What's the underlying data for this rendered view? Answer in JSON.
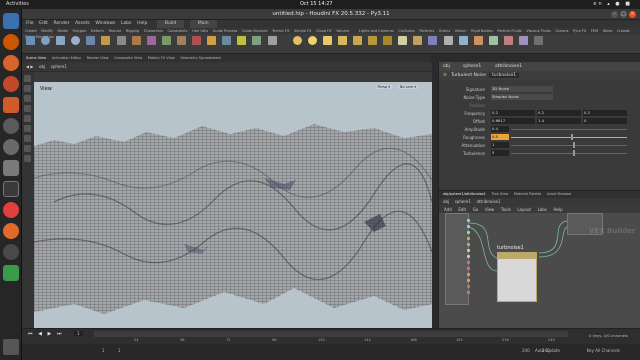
{
  "system": {
    "activities": "Activities",
    "clock": "Oct 15  14:27",
    "tray": "en  ▴  ●  ■"
  },
  "window": {
    "title": "untitled.hip - Houdini FX 20.5.332 - Py3.11"
  },
  "menu": [
    "File",
    "Edit",
    "Render",
    "Assets",
    "Windows",
    "Labs",
    "Help",
    "Build",
    "Main"
  ],
  "shelf_tabs": [
    "Create",
    "Modify",
    "Model",
    "Polygon",
    "Deform",
    "Texture",
    "Rigging",
    "Characters",
    "Constraints",
    "Hair Utils",
    "Guide Process",
    "Guide Brushes",
    "Terrain FX",
    "Simple FX",
    "Cloud FX",
    "Volume",
    "Lights and Cameras",
    "Collisions",
    "Particles",
    "Grains",
    "Vellum",
    "Rigid Bodies",
    "Particle Fluids",
    "Viscous Fluids",
    "Oceans",
    "Pyro FX",
    "FEM",
    "Wires",
    "Crowds",
    "Drive Simulation"
  ],
  "pane_tabs": [
    "Scene View",
    "Animation Editor",
    "Render View",
    "Composite View",
    "Motion FX View",
    "Geometry Spreadsheet"
  ],
  "viewport": {
    "path_obj": "obj",
    "path_node": "sphere1",
    "label": "View",
    "camera": "Persp ▾",
    "display": "No cam ▾"
  },
  "params": {
    "node_type": "Turbulent Noise",
    "node_name": "turbnoise1",
    "path_obj": "obj",
    "path_node": "sphere1",
    "path_ops": "attribnoise1",
    "rows": [
      {
        "label": "Signature",
        "values": [
          "3D Noise"
        ]
      },
      {
        "label": "Noise Type",
        "values": [
          "Simplex Noise"
        ]
      },
      {
        "label": "Position",
        "values": []
      },
      {
        "label": "Frequency",
        "values": [
          "0.2",
          "0.2",
          "0.2"
        ]
      },
      {
        "label": "Offset",
        "values": [
          "0.6617",
          "1.4",
          "0"
        ]
      },
      {
        "label": "Amplitude",
        "values": [
          "0.4"
        ]
      },
      {
        "label": "Roughness",
        "values": [
          "0.5"
        ]
      },
      {
        "label": "Attenuation",
        "values": [
          "1"
        ]
      },
      {
        "label": "Turbulence",
        "values": [
          "5"
        ]
      }
    ]
  },
  "network": {
    "tabs": [
      "obj/sphere1/attribnoise1",
      "Tree View",
      "Material Palette",
      "Asset Browser"
    ],
    "path_obj": "obj",
    "path_node": "sphere1",
    "path_ops": "attribnoise1",
    "menu": [
      "Add",
      "Edit",
      "Go",
      "View",
      "Tools",
      "Layout",
      "Labs",
      "Help"
    ],
    "node_name": "turbnoise1",
    "watermark": "VEX Builder"
  },
  "timeline": {
    "frame": "1",
    "start": "1",
    "end": "240",
    "ticks": [
      "24",
      "48",
      "72",
      "96",
      "120",
      "144",
      "168",
      "192",
      "216",
      "240"
    ],
    "keys_label": "0 keys, 0/0 channels",
    "key_all": "Key All Channels",
    "auto_update": "Auto Update"
  },
  "colors": {
    "accent": "#e8a33a",
    "viewport_bg": "#b8c4cc",
    "node_border": "#bda76a"
  }
}
